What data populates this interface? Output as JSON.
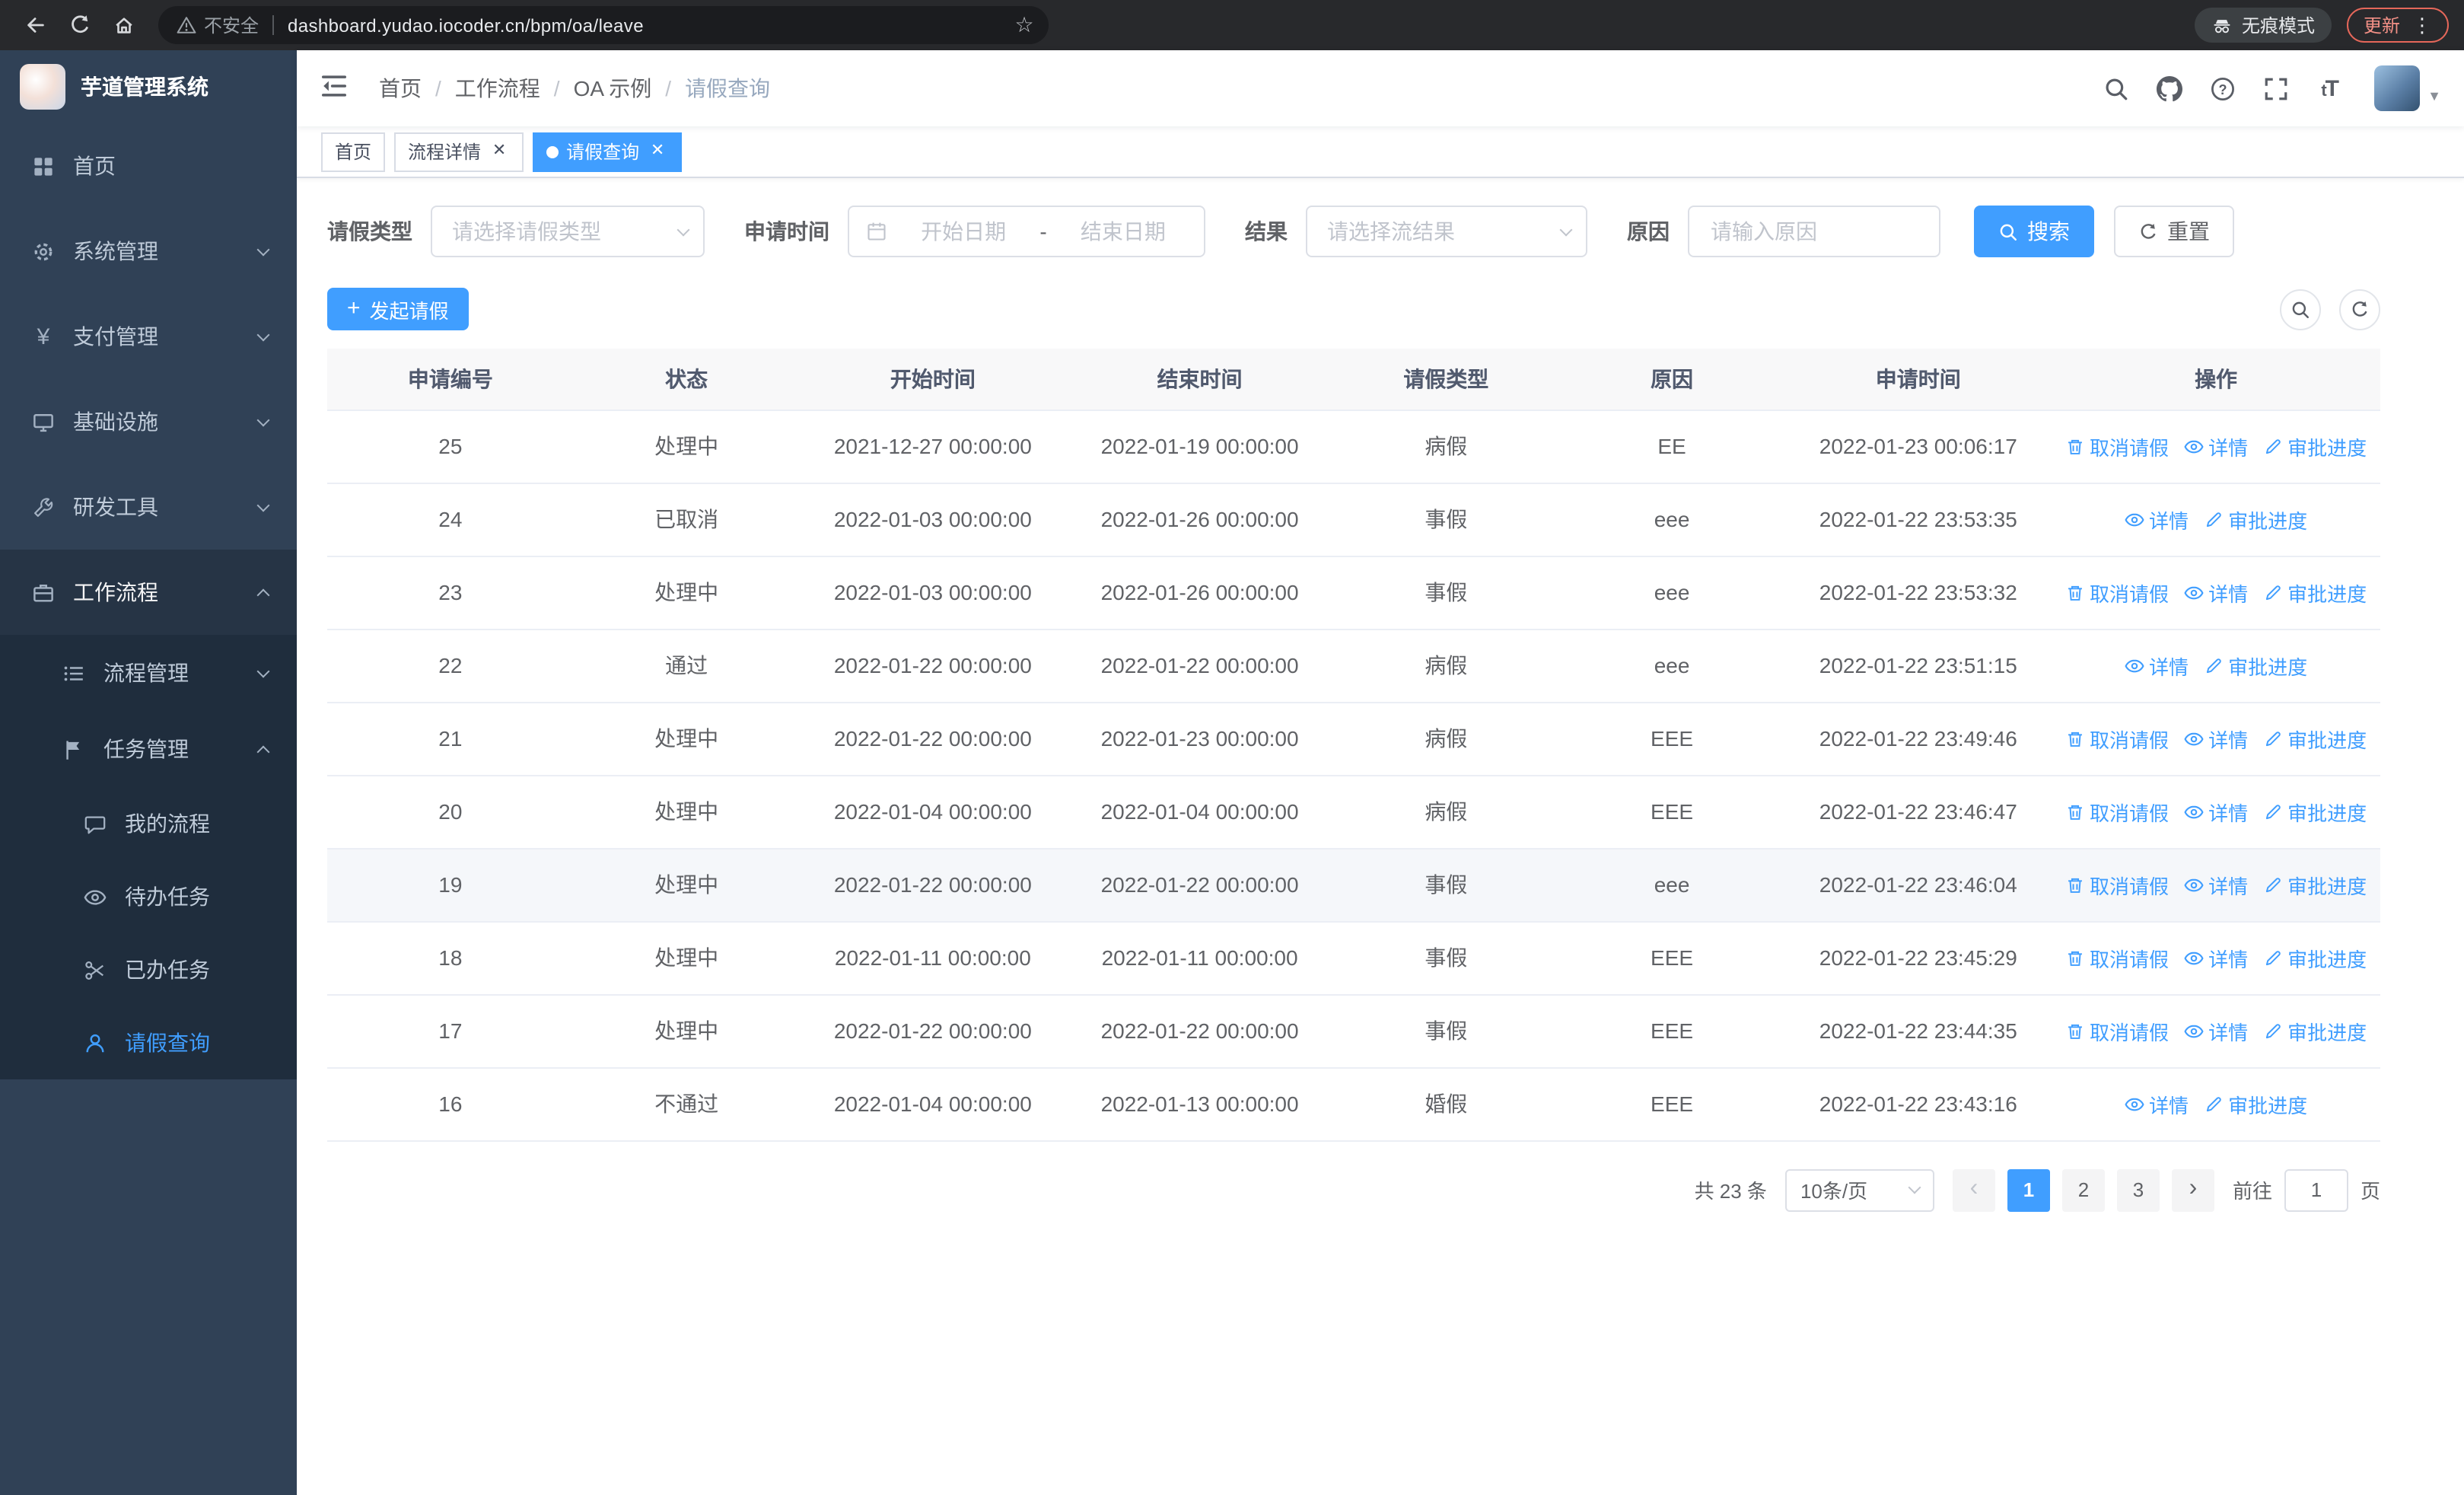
{
  "colors": {
    "accent": "#409eff",
    "sidebar_bg": "#304156",
    "sidebar_submenu_bg": "#1f2d3d",
    "active_tab_bg": "#409eff",
    "update_badge_border": "#e5675a",
    "table_header_bg": "#f8f8f9"
  },
  "browser": {
    "security_warning": "不安全",
    "url": "dashboard.yudao.iocoder.cn/bpm/oa/leave",
    "incognito_label": "无痕模式",
    "update_label": "更新"
  },
  "sidebar": {
    "title": "芋道管理系统",
    "items": [
      {
        "label": "首页"
      },
      {
        "label": "系统管理"
      },
      {
        "label": "支付管理"
      },
      {
        "label": "基础设施"
      },
      {
        "label": "研发工具"
      },
      {
        "label": "工作流程"
      },
      {
        "label": "流程管理"
      },
      {
        "label": "任务管理"
      },
      {
        "label": "我的流程"
      },
      {
        "label": "待办任务"
      },
      {
        "label": "已办任务"
      },
      {
        "label": "请假查询"
      }
    ]
  },
  "header": {
    "breadcrumb": [
      "首页",
      "工作流程",
      "OA 示例",
      "请假查询"
    ]
  },
  "tabs": [
    {
      "label": "首页"
    },
    {
      "label": "流程详情"
    },
    {
      "label": "请假查询"
    }
  ],
  "filters": {
    "leave_type_label": "请假类型",
    "leave_type_placeholder": "请选择请假类型",
    "apply_time_label": "申请时间",
    "start_date_placeholder": "开始日期",
    "date_separator": "-",
    "end_date_placeholder": "结束日期",
    "result_label": "结果",
    "result_placeholder": "请选择流结果",
    "reason_label": "原因",
    "reason_placeholder": "请输入原因",
    "search_button": "搜索",
    "reset_button": "重置"
  },
  "toolbar": {
    "create_button": "发起请假"
  },
  "table": {
    "columns": [
      "申请编号",
      "状态",
      "开始时间",
      "结束时间",
      "请假类型",
      "原因",
      "申请时间",
      "操作"
    ],
    "action_labels": {
      "cancel": "取消请假",
      "detail": "详情",
      "progress": "审批进度"
    },
    "rows": [
      {
        "id": "25",
        "status": "处理中",
        "start": "2021-12-27 00:00:00",
        "end": "2022-01-19 00:00:00",
        "type": "病假",
        "reason": "EE",
        "apply_time": "2022-01-23 00:06:17",
        "actions": [
          "cancel",
          "detail",
          "progress"
        ]
      },
      {
        "id": "24",
        "status": "已取消",
        "start": "2022-01-03 00:00:00",
        "end": "2022-01-26 00:00:00",
        "type": "事假",
        "reason": "eee",
        "apply_time": "2022-01-22 23:53:35",
        "actions": [
          "detail",
          "progress"
        ]
      },
      {
        "id": "23",
        "status": "处理中",
        "start": "2022-01-03 00:00:00",
        "end": "2022-01-26 00:00:00",
        "type": "事假",
        "reason": "eee",
        "apply_time": "2022-01-22 23:53:32",
        "actions": [
          "cancel",
          "detail",
          "progress"
        ]
      },
      {
        "id": "22",
        "status": "通过",
        "start": "2022-01-22 00:00:00",
        "end": "2022-01-22 00:00:00",
        "type": "病假",
        "reason": "eee",
        "apply_time": "2022-01-22 23:51:15",
        "actions": [
          "detail",
          "progress"
        ]
      },
      {
        "id": "21",
        "status": "处理中",
        "start": "2022-01-22 00:00:00",
        "end": "2022-01-23 00:00:00",
        "type": "病假",
        "reason": "EEE",
        "apply_time": "2022-01-22 23:49:46",
        "actions": [
          "cancel",
          "detail",
          "progress"
        ]
      },
      {
        "id": "20",
        "status": "处理中",
        "start": "2022-01-04 00:00:00",
        "end": "2022-01-04 00:00:00",
        "type": "病假",
        "reason": "EEE",
        "apply_time": "2022-01-22 23:46:47",
        "actions": [
          "cancel",
          "detail",
          "progress"
        ]
      },
      {
        "id": "19",
        "status": "处理中",
        "start": "2022-01-22 00:00:00",
        "end": "2022-01-22 00:00:00",
        "type": "事假",
        "reason": "eee",
        "apply_time": "2022-01-22 23:46:04",
        "actions": [
          "cancel",
          "detail",
          "progress"
        ],
        "highlighted": true
      },
      {
        "id": "18",
        "status": "处理中",
        "start": "2022-01-11 00:00:00",
        "end": "2022-01-11 00:00:00",
        "type": "事假",
        "reason": "EEE",
        "apply_time": "2022-01-22 23:45:29",
        "actions": [
          "cancel",
          "detail",
          "progress"
        ]
      },
      {
        "id": "17",
        "status": "处理中",
        "start": "2022-01-22 00:00:00",
        "end": "2022-01-22 00:00:00",
        "type": "事假",
        "reason": "EEE",
        "apply_time": "2022-01-22 23:44:35",
        "actions": [
          "cancel",
          "detail",
          "progress"
        ]
      },
      {
        "id": "16",
        "status": "不通过",
        "start": "2022-01-04 00:00:00",
        "end": "2022-01-13 00:00:00",
        "type": "婚假",
        "reason": "EEE",
        "apply_time": "2022-01-22 23:43:16",
        "actions": [
          "detail",
          "progress"
        ]
      }
    ]
  },
  "pagination": {
    "total": "共 23 条",
    "page_size": "10条/页",
    "pages": [
      "1",
      "2",
      "3"
    ],
    "active_page": "1",
    "goto_label": "前往",
    "goto_value": "1",
    "goto_unit": "页"
  }
}
